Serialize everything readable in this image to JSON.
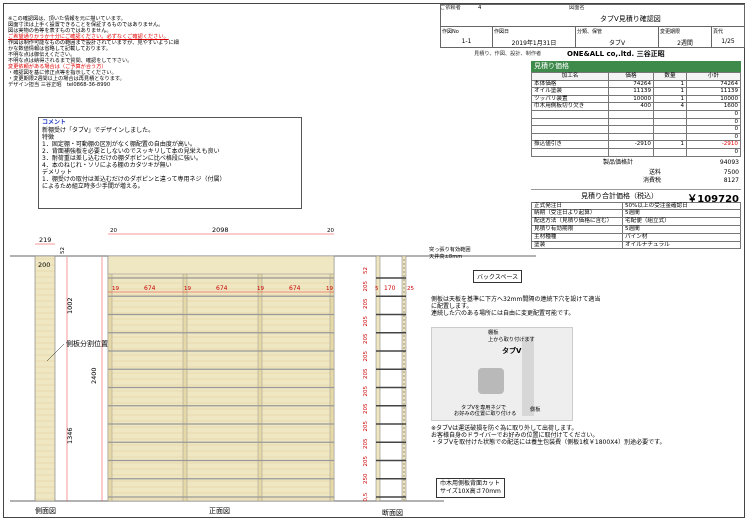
{
  "header": {
    "form_no_label": "ご依頼者",
    "form_no": "4",
    "drawing_label": "図面名",
    "drawing_title": "タブV見積り確認図",
    "rows": [
      {
        "label": "作図No",
        "value": "1-1"
      },
      {
        "label": "作図日",
        "value": "2019年1月31日"
      },
      {
        "label": "分類、保管",
        "value": "タブV"
      },
      {
        "label": "変更期限",
        "value": "2週間"
      },
      {
        "label": "頁代",
        "value": "1/25"
      }
    ],
    "maker_label": "見積り、作図、設計、制作者",
    "maker_value": "ONE&ALL co,.ltd. 三谷正昭"
  },
  "top_notes": [
    {
      "text": "※この確認図は、頂いた情報を元に描いています。",
      "color": "black"
    },
    {
      "text": "図面寸法は上手く設置できることを保証するものではありません。",
      "color": "black"
    },
    {
      "text": "図は実物の色等を表すものではありません。",
      "color": "black"
    },
    {
      "text": "ご希望通りかうか十分にご確認ください。必ずなくご確認ください。",
      "color": "red"
    },
    {
      "text": "作図は制作可能なものの範囲まで設計されていますが、見やすいように細",
      "color": "black"
    },
    {
      "text": "かな数値情報は省略して記載しております。",
      "color": "black"
    },
    {
      "text": "不明な点は御伝えください。",
      "color": "black"
    },
    {
      "text": "不明な点は納得されるまで質問、確認をして下さい。",
      "color": "black"
    },
    {
      "text": "変更依頼がある場合は（ご予算が合う方）",
      "color": "red"
    },
    {
      "text": "・確認図を基に修正点等を指示してください。",
      "color": "black"
    },
    {
      "text": "・変更期限2週間以上の場合は再見積となります。",
      "color": "black"
    },
    {
      "text": "デザイン担当 三谷正昭　tel0868-36-8990",
      "color": "black"
    }
  ],
  "comment": {
    "title": "コメント",
    "lines": [
      "新棚受け「タブV」でデザインしました。",
      "特徴",
      "1．固定棚・可動棚の区別がなく棚配置の自由度が高い。",
      "2．背面補強板を必要としないのでスッキリして本の見栄えも良い",
      "3．耐荷重は差し込むだけの棚ダボピンに比べ格段に強い。",
      "4．本のねじれ・ソリによる棚のカタツキが無い",
      "デメリット",
      "1．棚受けの取付は差込むだけのダボピンと違って専用ネジ（付属）",
      "によるため組立時多少手間が増える。"
    ]
  },
  "estimate": {
    "title": "見積り価格",
    "columns": [
      "加工名",
      "価格",
      "数量",
      "小計"
    ],
    "items": [
      {
        "name": "本体価格",
        "price": "74264",
        "qty": "1",
        "subtotal": "74264"
      },
      {
        "name": "オイル塗装",
        "price": "11139",
        "qty": "1",
        "subtotal": "11139"
      },
      {
        "name": "ツッパリ装置",
        "price": "10000",
        "qty": "1",
        "subtotal": "10000"
      },
      {
        "name": "巾木用側板切り欠き",
        "price": "400",
        "qty": "4",
        "subtotal": "1600"
      },
      {
        "name": "",
        "price": "",
        "qty": "",
        "subtotal": "0"
      },
      {
        "name": "",
        "price": "",
        "qty": "",
        "subtotal": "0"
      },
      {
        "name": "",
        "price": "",
        "qty": "",
        "subtotal": "0"
      },
      {
        "name": "",
        "price": "",
        "qty": "",
        "subtotal": "0"
      },
      {
        "name": "振込値引き",
        "price": "-2910",
        "qty": "1",
        "subtotal": "-2910"
      },
      {
        "name": "",
        "price": "",
        "qty": "",
        "subtotal": "0"
      }
    ],
    "summary": [
      {
        "label": "製品価格計",
        "value": "94093"
      },
      {
        "label": "送料",
        "value": "7500"
      },
      {
        "label": "消費税",
        "value": "8127"
      }
    ],
    "total_label": "見積り合計価格（税込）",
    "total_value": "￥109720",
    "specs": [
      {
        "label": "正式発注日",
        "value": "50%以上の受注金確認日"
      },
      {
        "label": "納期（受注日より起算）",
        "value": "5週間"
      },
      {
        "label": "配送方法（見積り価格に含む）",
        "value": "宅配便（組立式）"
      },
      {
        "label": "見積り有効期限",
        "value": "5週間"
      },
      {
        "label": "主材種種",
        "value": "パイン材"
      },
      {
        "label": "塗装",
        "value": "オイルナチュラル"
      }
    ]
  },
  "drawing": {
    "front_width": "2098",
    "side_margin": "20",
    "side_width": "219",
    "side_top": "200",
    "top_gap": "52",
    "front_height": "2400",
    "upper_height": "1002",
    "lower_height": "1346",
    "bay_width": "674",
    "post_width": "19",
    "section_width": "170",
    "section_post": "5",
    "section_gap": "25",
    "shelf_pitch": [
      "52",
      "205",
      "205",
      "205",
      "205",
      "205",
      "205",
      "205",
      "205",
      "205",
      "205",
      "205",
      "250",
      "0,5"
    ],
    "side_label": "側板分割位置",
    "tsuppari_label": "突っ張り有効範囲",
    "tsuppari_range": "天井高±8mm",
    "back_space_label": "バックスペース",
    "hole_note_lines": [
      "側板は天板を基準に下方へ32mm間隔の連続下穴を設けて適当",
      "に配置します。",
      "連続した穴のある場所には自由に変更配置可能です。"
    ],
    "photo_label_shelf": "棚板",
    "photo_label_shelf_sub": "上から取り付けます",
    "photo_label_tab": "タブV",
    "photo_label_side": "側板",
    "photo_label_screw": "タブVを専用ネジで",
    "photo_label_screw2": "お好みの位置に取り付ける",
    "bottom_notes": [
      "※タブVは運送破損を防ぐ為に取り外して出荷します。",
      "お客様自身のドライバーでお好みの位置に取付けてください。",
      "・タブVを取付けた状態での配送には養生包装費（側板1枚￥1800X4）別途必要です。"
    ],
    "baseboard_label": "巾木用側板背面カット",
    "baseboard_size": "サイズ10X高さ70mm",
    "view_side": "側面図",
    "view_front": "正面図",
    "view_section": "断面図"
  }
}
